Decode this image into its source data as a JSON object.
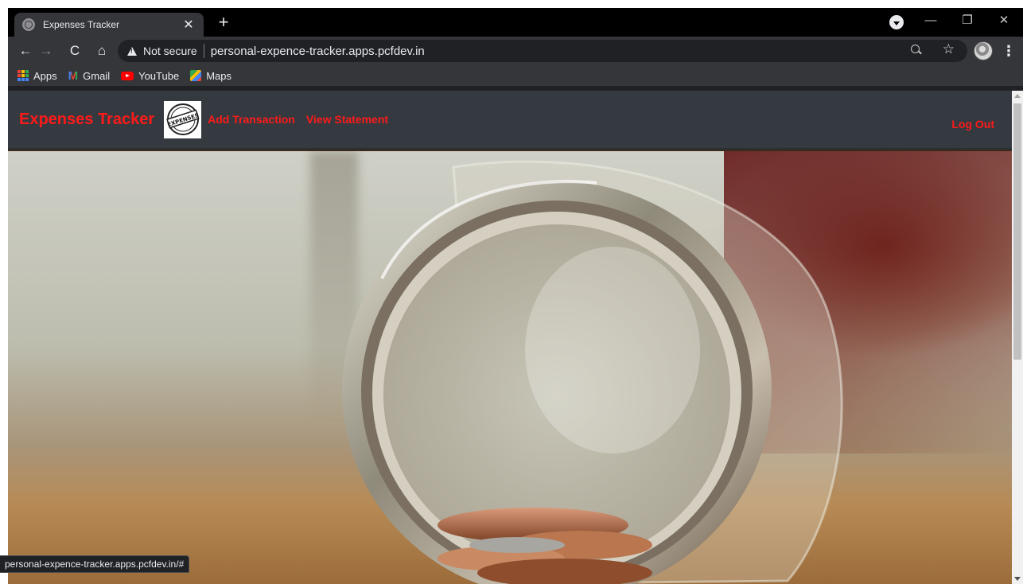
{
  "tab": {
    "title": "Expenses Tracker",
    "close_glyph": "✕"
  },
  "new_tab_glyph": "+",
  "window": {
    "minimize": "—",
    "maximize": "❐",
    "close": "✕"
  },
  "toolbar": {
    "back": "←",
    "forward": "→",
    "reload": "C",
    "home": "⌂",
    "security_label": "Not secure",
    "url": "personal-expence-tracker.apps.pcfdev.in",
    "star": "☆",
    "menu": "⋮"
  },
  "bookmarks": [
    {
      "label": "Apps",
      "icon": "apps-grid-icon"
    },
    {
      "label": "Gmail",
      "icon": "gmail-icon"
    },
    {
      "label": "YouTube",
      "icon": "youtube-icon"
    },
    {
      "label": "Maps",
      "icon": "maps-icon"
    }
  ],
  "gmail_glyph": "M",
  "navbar": {
    "brand": "Expenses Tracker",
    "logo_text": "EXPENSES",
    "links": [
      "Add Transaction",
      "View Statement"
    ],
    "logout": "Log Out"
  },
  "status_bar": "personal-expence-tracker.apps.pcfdev.in/#",
  "colors": {
    "navbar_bg": "#343a40",
    "brand_red": "#ff1a1a",
    "browser_chrome": "#35363a"
  }
}
